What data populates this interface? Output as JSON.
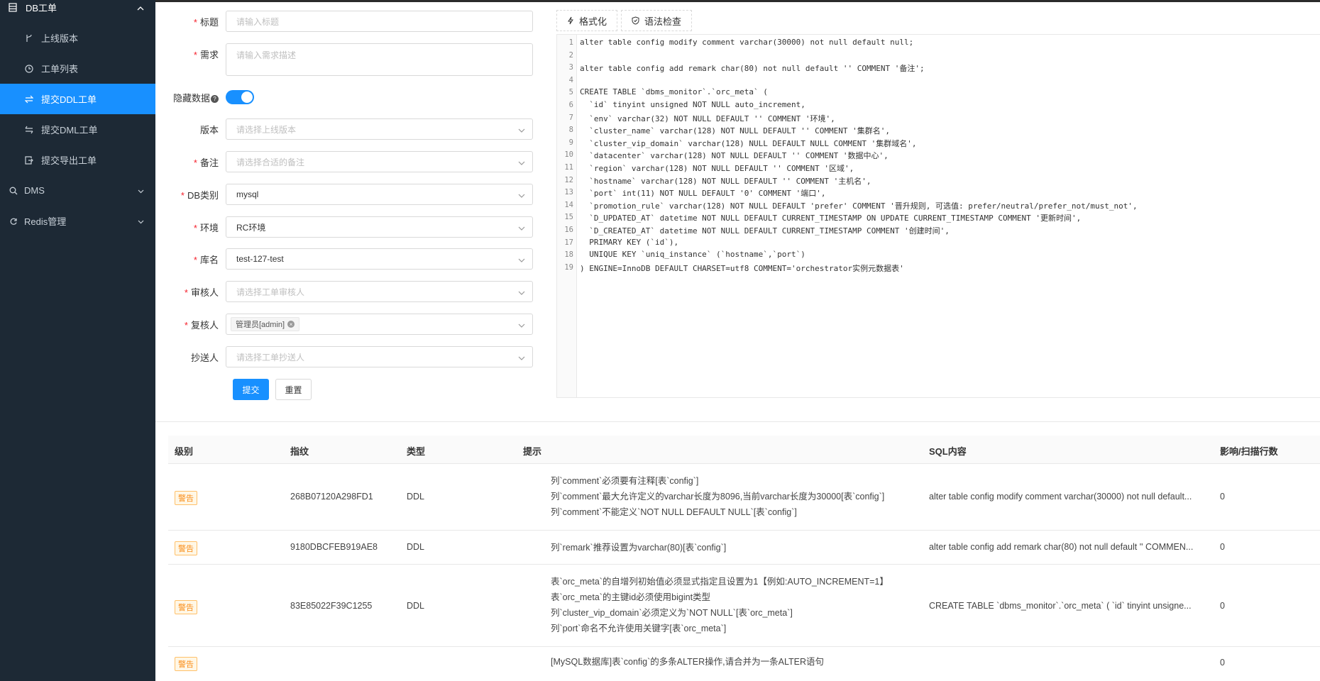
{
  "sidebar": {
    "group_title": "DB工单",
    "items": [
      {
        "label": "上线版本",
        "icon": "branch-icon"
      },
      {
        "label": "工单列表",
        "icon": "clock-icon"
      },
      {
        "label": "提交DDL工单",
        "icon": "swap-icon",
        "active": true
      },
      {
        "label": "提交DML工单",
        "icon": "swap-horizontal-icon"
      },
      {
        "label": "提交导出工单",
        "icon": "export-icon"
      }
    ],
    "top_items": [
      {
        "label": "DMS",
        "icon": "search-icon"
      },
      {
        "label": "Redis管理",
        "icon": "sync-icon"
      }
    ]
  },
  "form": {
    "title": {
      "label": "标题",
      "placeholder": "请输入标题"
    },
    "demand": {
      "label": "需求",
      "placeholder": "请输入需求描述"
    },
    "hide_data": {
      "label": "隐藏数据",
      "on": true
    },
    "version": {
      "label": "版本",
      "placeholder": "请选择上线版本"
    },
    "remark": {
      "label": "备注",
      "placeholder": "请选择合适的备注"
    },
    "db_type": {
      "label": "DB类别",
      "value": "mysql"
    },
    "env": {
      "label": "环境",
      "value": "RC环境"
    },
    "db_name": {
      "label": "库名",
      "value": "test-127-test"
    },
    "auditor": {
      "label": "审核人",
      "placeholder": "请选择工单审核人"
    },
    "reviewer": {
      "label": "复核人",
      "tag": "管理员[admin]"
    },
    "cc": {
      "label": "抄送人",
      "placeholder": "请选择工单抄送人"
    },
    "submit_label": "提交",
    "reset_label": "重置"
  },
  "editor": {
    "format_label": "格式化",
    "check_label": "语法检查",
    "lines": [
      "alter table config modify comment varchar(30000) not null default null;",
      "",
      "alter table config add remark char(80) not null default '' COMMENT '备注';",
      "",
      "CREATE TABLE `dbms_monitor`.`orc_meta` (",
      "  `id` tinyint unsigned NOT NULL auto_increment,",
      "  `env` varchar(32) NOT NULL DEFAULT '' COMMENT '环境',",
      "  `cluster_name` varchar(128) NOT NULL DEFAULT '' COMMENT '集群名',",
      "  `cluster_vip_domain` varchar(128) NULL DEFAULT NULL COMMENT '集群域名',",
      "  `datacenter` varchar(128) NOT NULL DEFAULT '' COMMENT '数据中心',",
      "  `region` varchar(128) NOT NULL DEFAULT '' COMMENT '区域',",
      "  `hostname` varchar(128) NOT NULL DEFAULT '' COMMENT '主机名',",
      "  `port` int(11) NOT NULL DEFAULT '0' COMMENT '端口',",
      "  `promotion_rule` varchar(128) NOT NULL DEFAULT 'prefer' COMMENT '晋升规则, 可选值: prefer/neutral/prefer_not/must_not',",
      "  `D_UPDATED_AT` datetime NOT NULL DEFAULT CURRENT_TIMESTAMP ON UPDATE CURRENT_TIMESTAMP COMMENT '更新时间',",
      "  `D_CREATED_AT` datetime NOT NULL DEFAULT CURRENT_TIMESTAMP COMMENT '创建时间',",
      "  PRIMARY KEY (`id`),",
      "  UNIQUE KEY `uniq_instance` (`hostname`,`port`)",
      ") ENGINE=InnoDB DEFAULT CHARSET=utf8 COMMENT='orchestrator实例元数据表'"
    ]
  },
  "table": {
    "headers": [
      "级别",
      "指纹",
      "类型",
      "提示",
      "SQL内容",
      "影响/扫描行数"
    ],
    "rows": [
      {
        "level": "警告",
        "fingerprint": "268B07120A298FD1",
        "type": "DDL",
        "tips": [
          "列`comment`必须要有注释[表`config`]",
          "列`comment`最大允许定义的varchar长度为8096,当前varchar长度为30000[表`config`]",
          "列`comment`不能定义`NOT NULL DEFAULT NULL`[表`config`]"
        ],
        "sql": "alter table config modify comment varchar(30000) not null default...",
        "rows": "0"
      },
      {
        "level": "警告",
        "fingerprint": "9180DBCFEB919AE8",
        "type": "DDL",
        "tips": [
          "列`remark`推荐设置为varchar(80)[表`config`]"
        ],
        "sql": "alter table config add remark char(80) not null default '' COMMEN...",
        "rows": "0"
      },
      {
        "level": "警告",
        "fingerprint": "83E85022F39C1255",
        "type": "DDL",
        "tips": [
          "表`orc_meta`的自增列初始值必须显式指定且设置为1【例如:AUTO_INCREMENT=1】",
          "表`orc_meta`的主键id必须使用bigint类型",
          "列`cluster_vip_domain`必须定义为`NOT NULL`[表`orc_meta`]",
          "列`port`命名不允许使用关键字[表`orc_meta`]"
        ],
        "sql": "CREATE TABLE `dbms_monitor`.`orc_meta` ( `id` tinyint unsigne...",
        "rows": "0"
      },
      {
        "level": "警告",
        "fingerprint": "",
        "type": "",
        "tips": [
          "[MySQL数据库]表`config`的多条ALTER操作,请合并为一条ALTER语句"
        ],
        "sql": "",
        "rows": "0"
      }
    ]
  }
}
